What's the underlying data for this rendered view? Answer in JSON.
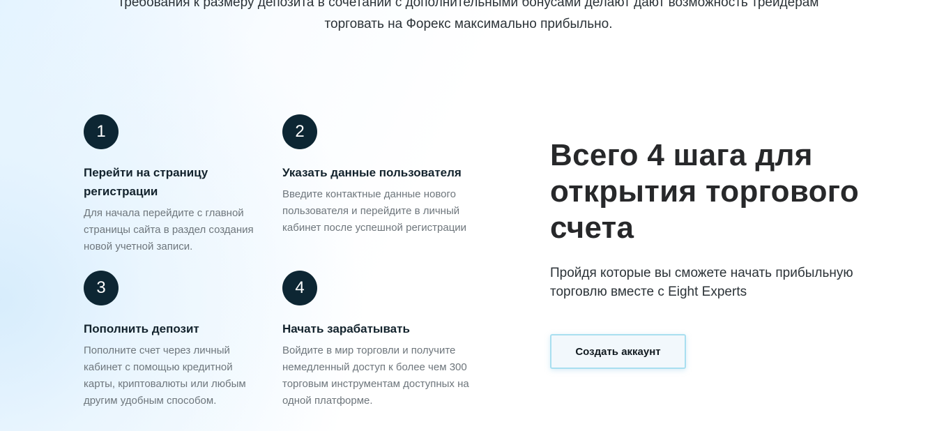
{
  "intro": {
    "line1": "требования к размеру депозита в сочетании с дополнительными бонусами делают дают возможность трейдерам",
    "line2": "торговать на Форекс максимально прибыльно."
  },
  "steps": [
    {
      "number": "1",
      "title": "Перейти на страницу регистрации",
      "description": "Для начала перейдите с главной страницы сайта в раздел создания новой учетной записи."
    },
    {
      "number": "2",
      "title": "Указать данные пользователя",
      "description": "Введите контактные данные нового пользователя и перейдите в личный кабинет после успешной регистрации"
    },
    {
      "number": "3",
      "title": "Пополнить депозит",
      "description": "Пополните счет через личный кабинет с помощью кредитной карты, криптовалюты или любым другим удобным способом."
    },
    {
      "number": "4",
      "title": "Начать зарабатывать",
      "description": "Войдите в мир торговли и получите немедленный доступ к более чем 300 торговым инструментам доступных на одной платформе."
    }
  ],
  "headline": "Всего 4 шага для открытия торгового счета",
  "subtext": "Пройдя которые вы сможете начать прибыльную торговлю вместе с Eight Experts",
  "cta": {
    "label": "Создать аккаунт"
  },
  "colors": {
    "step_circle": "#0d2633",
    "cta_border": "#a9dff0",
    "headline": "#27282a"
  }
}
